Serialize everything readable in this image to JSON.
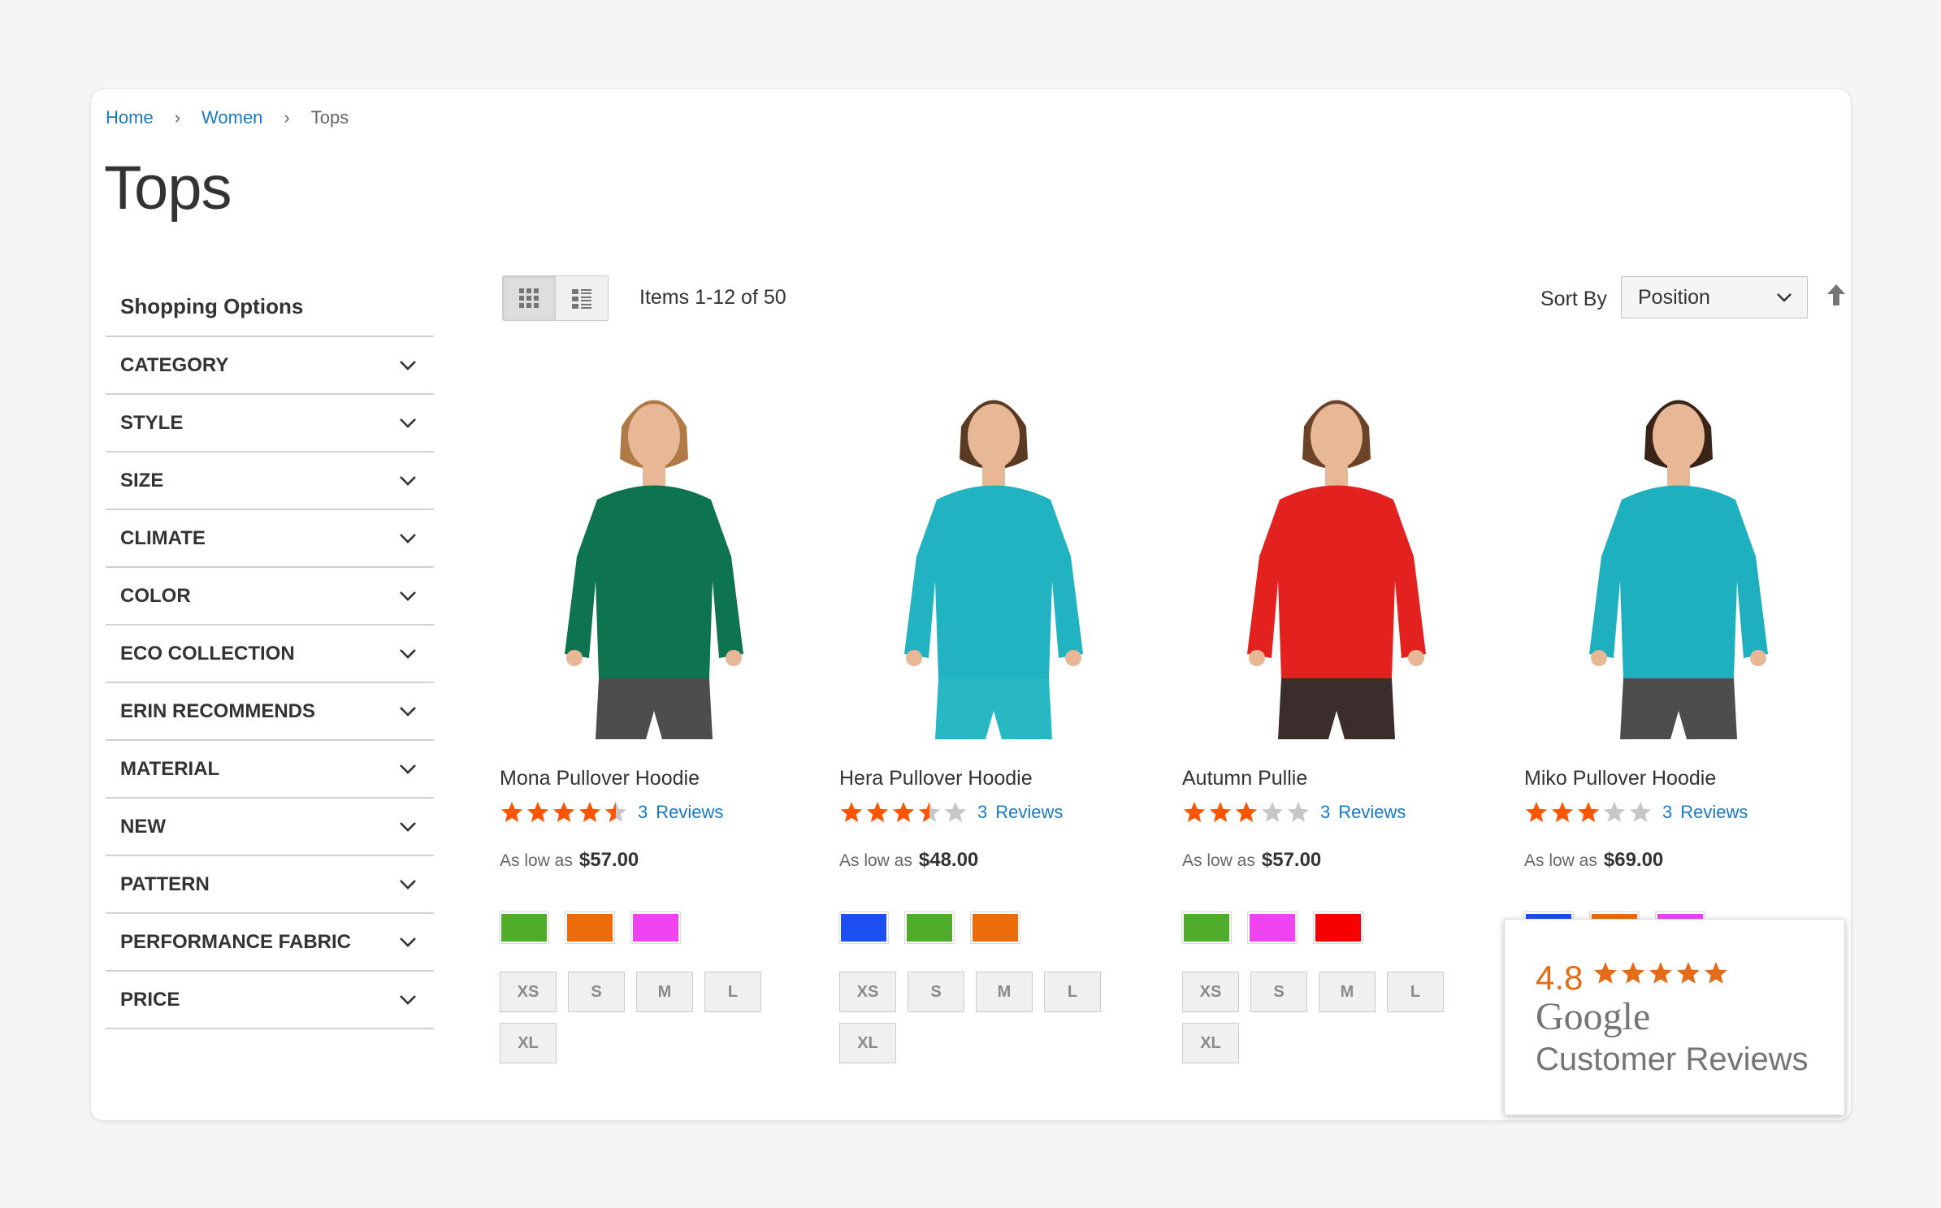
{
  "breadcrumb": {
    "home": "Home",
    "women": "Women",
    "current": "Tops",
    "separator": "›"
  },
  "page_title": "Tops",
  "sidebar": {
    "title": "Shopping Options",
    "filters": [
      "CATEGORY",
      "STYLE",
      "SIZE",
      "CLIMATE",
      "COLOR",
      "ECO COLLECTION",
      "ERIN RECOMMENDS",
      "MATERIAL",
      "NEW",
      "PATTERN",
      "PERFORMANCE FABRIC",
      "PRICE"
    ]
  },
  "toolbar": {
    "items_count": "Items 1-12 of 50",
    "sort_label": "Sort By",
    "sort_value": "Position"
  },
  "colors": {
    "link": "#1979c3",
    "star": "#ff5501",
    "star_empty": "#c7c7c7",
    "google_orange": "#e56b18"
  },
  "products": [
    {
      "name": "Mona Pullover Hoodie",
      "rating": 4.5,
      "reviews_count": "3",
      "reviews_label": "Reviews",
      "price_prefix": "As low as",
      "price": "$57.00",
      "shirt_color": "#0e7450",
      "bottom_color": "#4d4d4d",
      "swatches": [
        "#4fad2b",
        "#ec6b0a",
        "#ef42f1"
      ],
      "sizes": [
        "XS",
        "S",
        "M",
        "L",
        "XL"
      ]
    },
    {
      "name": "Hera Pullover Hoodie",
      "rating": 3.5,
      "reviews_count": "3",
      "reviews_label": "Reviews",
      "price_prefix": "As low as",
      "price": "$48.00",
      "shirt_color": "#21b3c1",
      "bottom_color": "#27b8c4",
      "swatches": [
        "#1c4ef2",
        "#4fad2b",
        "#ec6b0a"
      ],
      "sizes": [
        "XS",
        "S",
        "M",
        "L",
        "XL"
      ]
    },
    {
      "name": "Autumn Pullie",
      "rating": 3,
      "reviews_count": "3",
      "reviews_label": "Reviews",
      "price_prefix": "As low as",
      "price": "$57.00",
      "shirt_color": "#e3211f",
      "bottom_color": "#3a2d2b",
      "swatches": [
        "#4fad2b",
        "#ef42f1",
        "#f90000"
      ],
      "sizes": [
        "XS",
        "S",
        "M",
        "L",
        "XL"
      ]
    },
    {
      "name": "Miko Pullover Hoodie",
      "rating": 3,
      "reviews_count": "3",
      "reviews_label": "Reviews",
      "price_prefix": "As low as",
      "price": "$69.00",
      "shirt_color": "#1fb0bf",
      "bottom_color": "#4d4d4d",
      "swatches": [
        "#1c4ef2",
        "#ec6b0a",
        "#ef42f1"
      ],
      "sizes": []
    }
  ],
  "google_badge": {
    "score": "4.8",
    "rating": 5,
    "brand": "Google",
    "label": "Customer Reviews"
  }
}
